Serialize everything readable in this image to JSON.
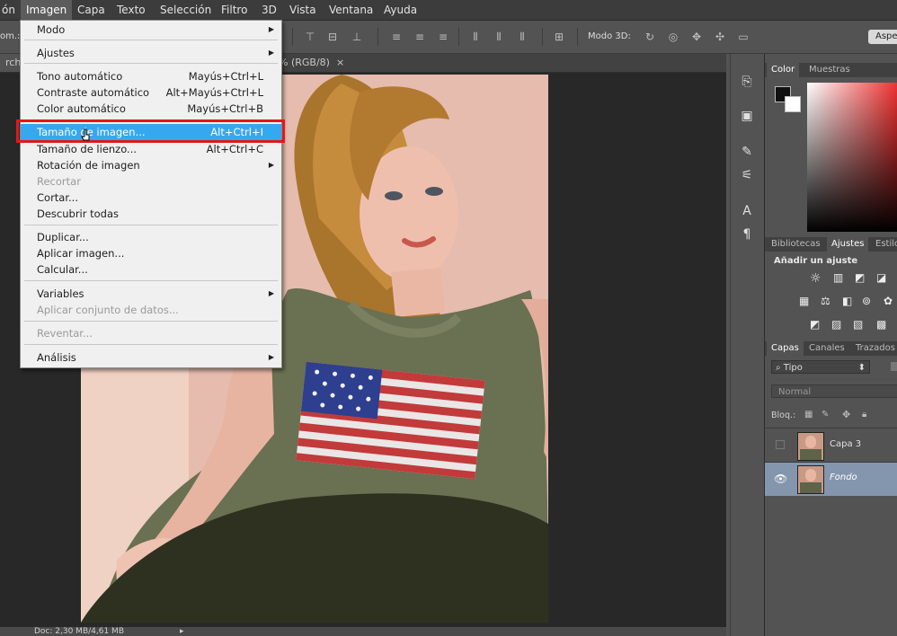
{
  "menubar": {
    "items": [
      "ón",
      "Imagen",
      "Capa",
      "Texto",
      "Selección",
      "Filtro",
      "3D",
      "Vista",
      "Ventana",
      "Ayuda"
    ]
  },
  "options": {
    "left_fragment": "om.:",
    "mode3d_label": "Modo 3D:",
    "right_button": "Aspe"
  },
  "document": {
    "tab_fragment": "rch.j",
    "tab_info": "% (RGB/8)"
  },
  "status": {
    "doc": "Doc: 2,30 MB/4,61 MB"
  },
  "menu": {
    "items": [
      {
        "label": "Modo",
        "shortcut": "",
        "submenu": true,
        "disabled": false,
        "highlight": false
      },
      {
        "label": "Ajustes",
        "shortcut": "",
        "submenu": true,
        "disabled": false,
        "highlight": false
      },
      {
        "label": "Tono automático",
        "shortcut": "Mayús+Ctrl+L",
        "submenu": false,
        "disabled": false,
        "highlight": false
      },
      {
        "label": "Contraste automático",
        "shortcut": "Alt+Mayús+Ctrl+L",
        "submenu": false,
        "disabled": false,
        "highlight": false
      },
      {
        "label": "Color automático",
        "shortcut": "Mayús+Ctrl+B",
        "submenu": false,
        "disabled": false,
        "highlight": false
      },
      {
        "label": "Tamaño de imagen...",
        "shortcut": "Alt+Ctrl+I",
        "submenu": false,
        "disabled": false,
        "highlight": true
      },
      {
        "label": "Tamaño de lienzo...",
        "shortcut": "Alt+Ctrl+C",
        "submenu": false,
        "disabled": false,
        "highlight": false
      },
      {
        "label": "Rotación de imagen",
        "shortcut": "",
        "submenu": true,
        "disabled": false,
        "highlight": false
      },
      {
        "label": "Recortar",
        "shortcut": "",
        "submenu": false,
        "disabled": true,
        "highlight": false
      },
      {
        "label": "Cortar...",
        "shortcut": "",
        "submenu": false,
        "disabled": false,
        "highlight": false
      },
      {
        "label": "Descubrir todas",
        "shortcut": "",
        "submenu": false,
        "disabled": false,
        "highlight": false
      },
      {
        "label": "Duplicar...",
        "shortcut": "",
        "submenu": false,
        "disabled": false,
        "highlight": false
      },
      {
        "label": "Aplicar imagen...",
        "shortcut": "",
        "submenu": false,
        "disabled": false,
        "highlight": false
      },
      {
        "label": "Calcular...",
        "shortcut": "",
        "submenu": false,
        "disabled": false,
        "highlight": false
      },
      {
        "label": "Variables",
        "shortcut": "",
        "submenu": true,
        "disabled": false,
        "highlight": false
      },
      {
        "label": "Aplicar conjunto de datos...",
        "shortcut": "",
        "submenu": false,
        "disabled": true,
        "highlight": false
      },
      {
        "label": "Reventar...",
        "shortcut": "",
        "submenu": false,
        "disabled": true,
        "highlight": false
      },
      {
        "label": "Análisis",
        "shortcut": "",
        "submenu": true,
        "disabled": false,
        "highlight": false
      }
    ]
  },
  "color_panel": {
    "tabs": [
      "Color",
      "Muestras"
    ]
  },
  "adjust_panel": {
    "tabs": [
      "Bibliotecas",
      "Ajustes",
      "Estilo"
    ],
    "title": "Añadir un ajuste"
  },
  "layers_panel": {
    "tabs": [
      "Capas",
      "Canales",
      "Trazados"
    ],
    "filter": "Tipo",
    "blend": "Normal",
    "lock_label": "Bloq.:",
    "layers": [
      {
        "name": "Capa 3",
        "visible": false,
        "selected": false
      },
      {
        "name": "Fondo",
        "visible": true,
        "selected": true
      }
    ]
  },
  "colors": {
    "menu_highlight": "#36a8ef",
    "red_box": "#e01919",
    "layer_selected": "#8496ae"
  }
}
